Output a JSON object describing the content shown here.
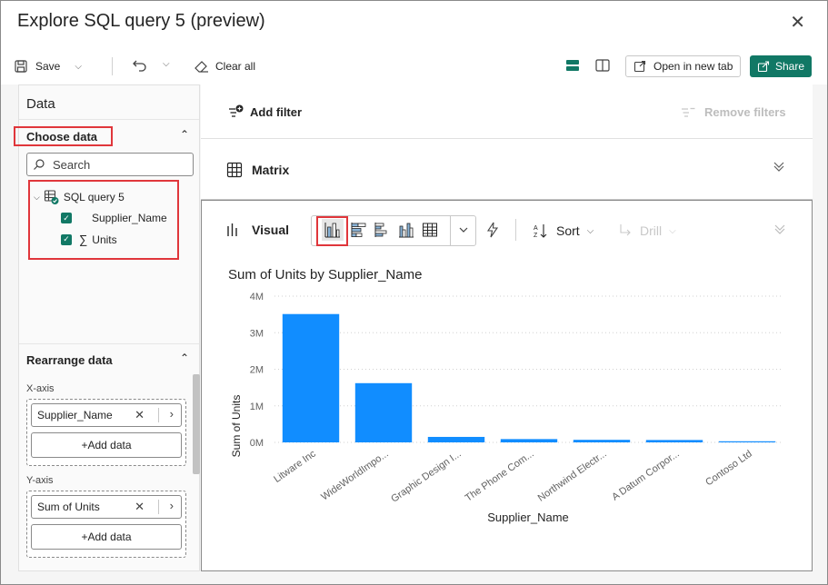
{
  "window": {
    "title": "Explore SQL query 5 (preview)"
  },
  "toolbar": {
    "save_label": "Save",
    "clear_all_label": "Clear all",
    "open_new_tab_label": "Open in new tab",
    "share_label": "Share"
  },
  "sidebar": {
    "title": "Data",
    "choose_data_title": "Choose data",
    "search_placeholder": "Search",
    "tree": {
      "root_label": "SQL query 5",
      "fields": [
        {
          "label": "Supplier_Name",
          "checked": true,
          "icon": ""
        },
        {
          "label": "Units",
          "checked": true,
          "icon": "sigma-icon"
        }
      ]
    },
    "rearrange_title": "Rearrange data",
    "x_axis_label": "X-axis",
    "x_axis_field": "Supplier_Name",
    "y_axis_label": "Y-axis",
    "y_axis_field": "Sum of Units",
    "add_data_label": "+Add data"
  },
  "filters": {
    "add_filter_label": "Add filter",
    "remove_filters_label": "Remove filters"
  },
  "matrix": {
    "label": "Matrix"
  },
  "visual": {
    "label": "Visual",
    "sort_label": "Sort",
    "drill_label": "Drill"
  },
  "chart_data": {
    "type": "bar",
    "title": "Sum of Units by Supplier_Name",
    "xlabel": "Supplier_Name",
    "ylabel": "Sum of Units",
    "ylim": [
      0,
      4000000
    ],
    "yticks": [
      "0M",
      "1M",
      "2M",
      "3M",
      "4M"
    ],
    "grid": true,
    "color": "#118DFF",
    "categories": [
      "Litware Inc",
      "WideWorldImpo...",
      "Graphic Design I...",
      "The Phone Com...",
      "Northwind Electr...",
      "A Datum Corpor...",
      "Contoso Ltd"
    ],
    "values": [
      3510000,
      1620000,
      150000,
      90000,
      70000,
      65000,
      30000
    ]
  },
  "colors": {
    "accent": "#117865",
    "highlight": "#E0363B",
    "bar": "#118DFF"
  }
}
